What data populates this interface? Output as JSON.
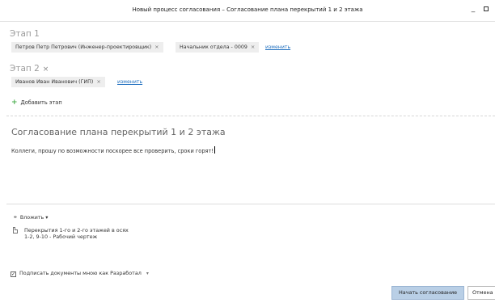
{
  "window": {
    "title": "Новый процесс согласования – Согласование плана перекрытий 1 и 2 этажа",
    "minimize": "_",
    "maximize": ""
  },
  "stages": [
    {
      "title": "Этап 1",
      "participants": [
        "Петров Петр Петрович (Инженер-проектировщик)",
        "Начальник отдела - 0009"
      ],
      "change_link": "изменить"
    },
    {
      "title": "Этап 2",
      "close": "×",
      "participants": [
        "Иванов Иван Иванович (ГИП)"
      ],
      "change_link": "изменить"
    }
  ],
  "remove_glyph": "×",
  "add_stage": "Добавить этап",
  "subject": "Согласование плана перекрытий 1 и 2 этажа",
  "message": "Коллеги, прошу по возможности поскорее все проверить, сроки горят!",
  "attach": {
    "label": "Вложить",
    "dropdown": "▾"
  },
  "document": {
    "name": "Перекрытия 1-го и 2-го этажей в осях",
    "details": "1-2, 9-10 - Рабочий чертеж"
  },
  "sign": {
    "checked": true,
    "label": "Подписать документы мною как",
    "role": "Разработал",
    "dropdown": "▾"
  },
  "buttons": {
    "start": "Начать согласование",
    "cancel": "Отмена"
  }
}
